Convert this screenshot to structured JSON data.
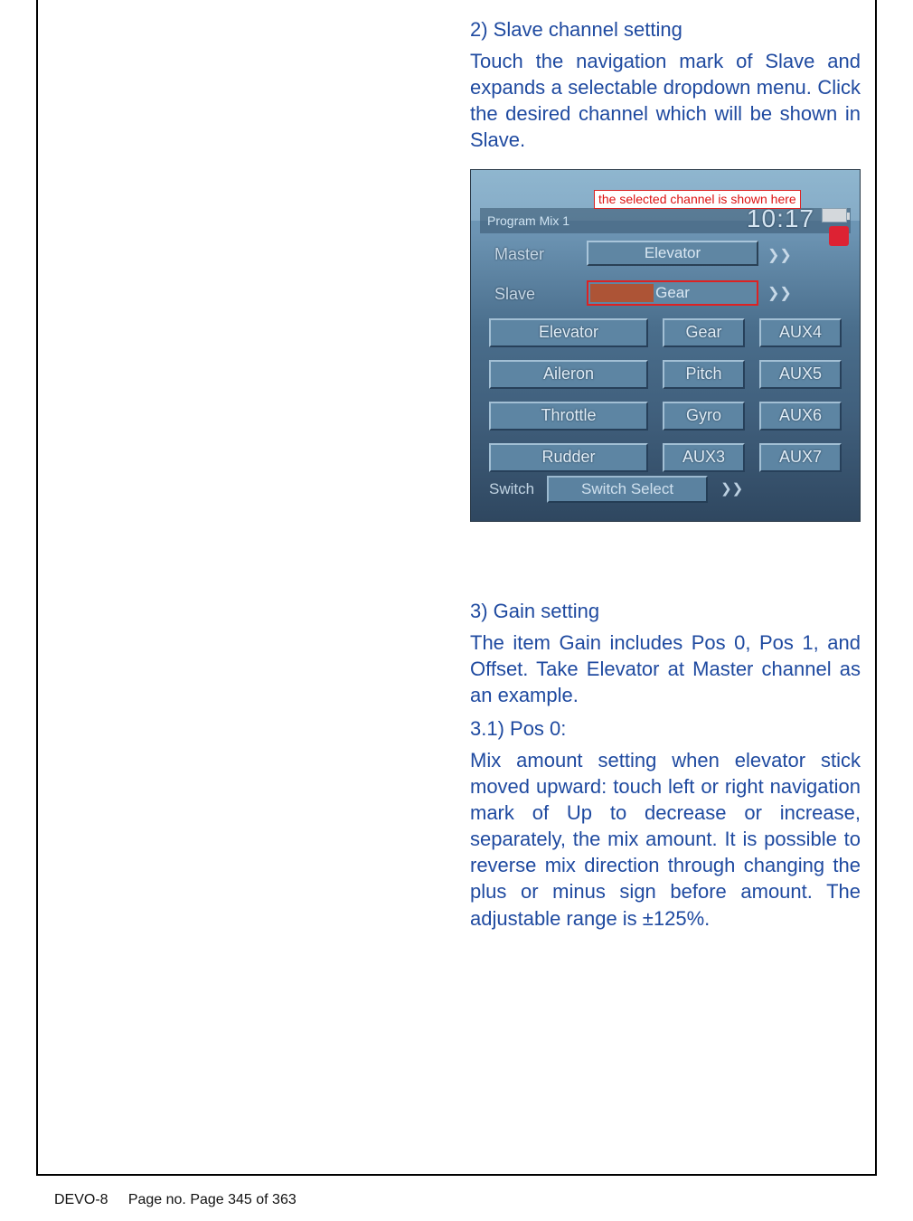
{
  "section2": {
    "heading": "2)  Slave channel setting",
    "para": "Touch the navigation mark of Slave and expands a selectable dropdown menu. Click the desired channel which will be shown in Slave."
  },
  "screenshot": {
    "title": "Program Mix 1",
    "clock": "10:17",
    "callout": "the selected channel is shown here",
    "master_label": "Master",
    "master_value": "Elevator",
    "slave_label": "Slave",
    "slave_value": "Gear",
    "grid": [
      {
        "left": "Elevator",
        "right": "Gear",
        "aux": "AUX4"
      },
      {
        "left": "Aileron",
        "right": "Pitch",
        "aux": "AUX5"
      },
      {
        "left": "Throttle",
        "right": "Gyro",
        "aux": "AUX6"
      },
      {
        "left": "Rudder",
        "right": "AUX3",
        "aux": "AUX7"
      }
    ],
    "switch_label": "Switch",
    "switch_value": "Switch Select"
  },
  "section3": {
    "heading": "3)  Gain setting",
    "para1": "The item Gain includes Pos 0, Pos 1, and Offset. Take Elevator at Master channel as an example.",
    "sub": "3.1) Pos 0:",
    "para2": "Mix amount setting when elevator stick moved upward: touch left or right navigation mark of Up to decrease or increase, separately, the mix amount. It is possible to reverse mix direction through changing the plus or minus sign before amount. The adjustable range is ±125%."
  },
  "footer": {
    "model": "DEVO-8",
    "page": "Page no. Page 345 of 363"
  }
}
